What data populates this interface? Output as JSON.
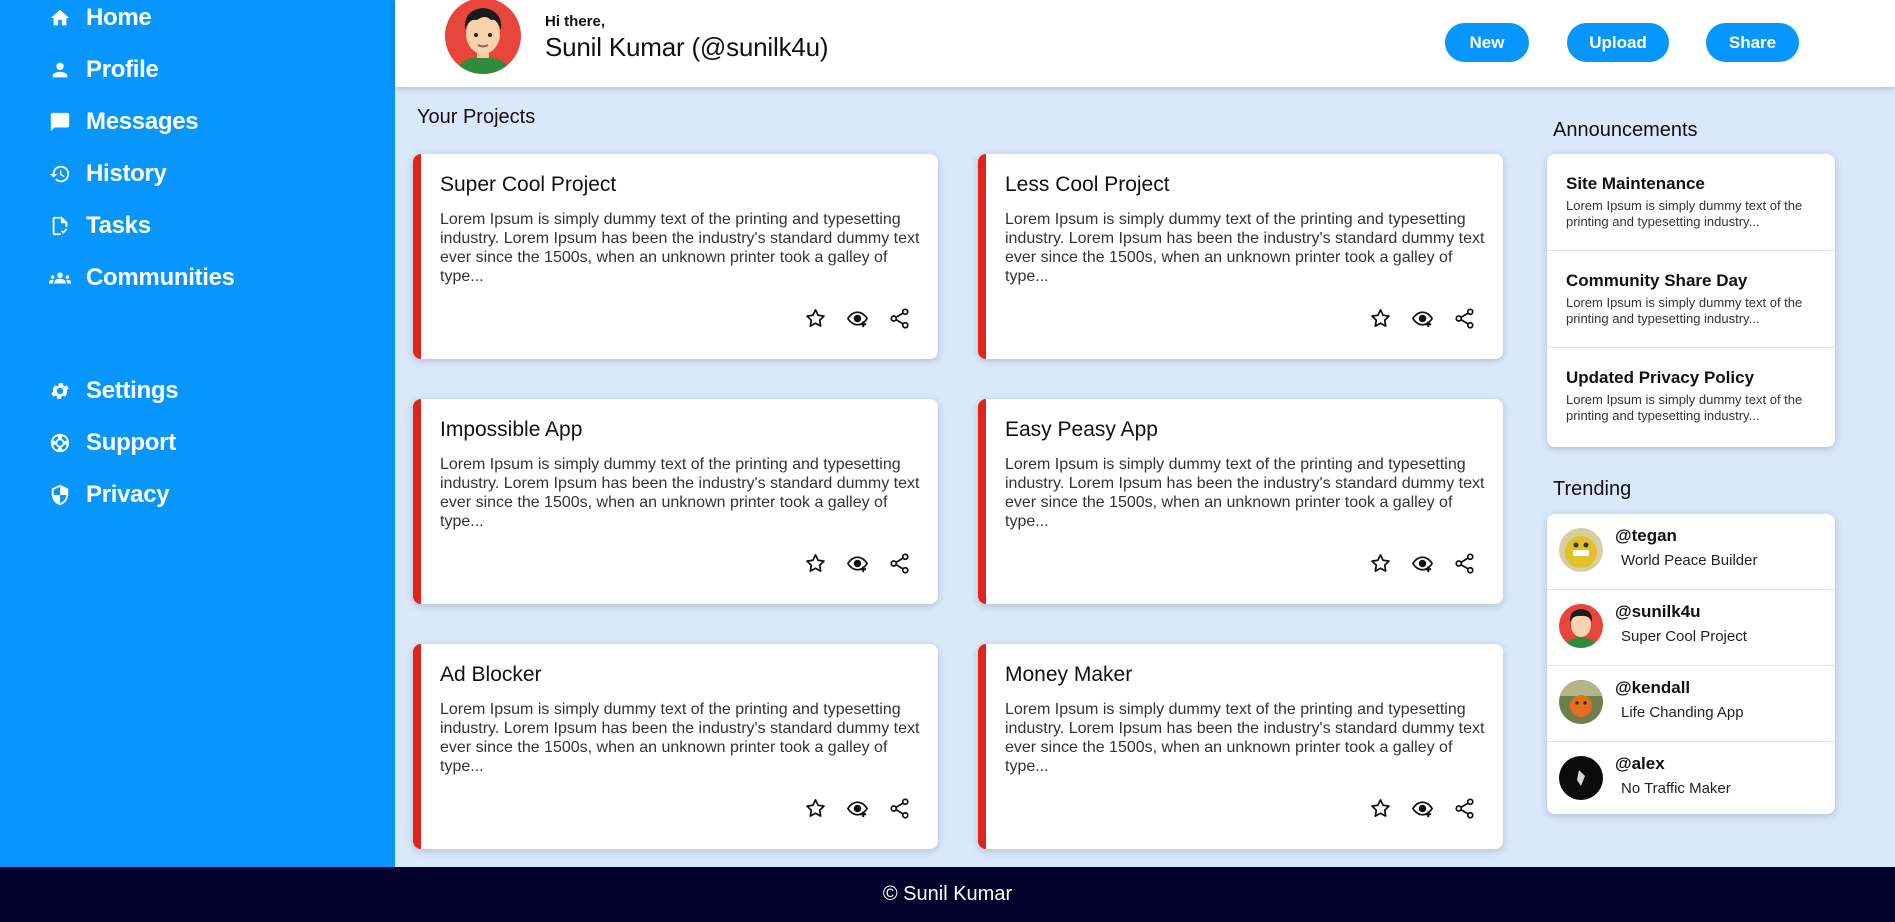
{
  "sidebar": {
    "items": [
      {
        "label": "Home",
        "icon": "home-icon"
      },
      {
        "label": "Profile",
        "icon": "user-icon"
      },
      {
        "label": "Messages",
        "icon": "chat-icon"
      },
      {
        "label": "History",
        "icon": "history-icon"
      },
      {
        "label": "Tasks",
        "icon": "task-icon"
      },
      {
        "label": "Communities",
        "icon": "group-icon"
      },
      {
        "label": "Settings",
        "icon": "gear-icon"
      },
      {
        "label": "Support",
        "icon": "lifebuoy-icon"
      },
      {
        "label": "Privacy",
        "icon": "shield-icon"
      }
    ]
  },
  "header": {
    "greeting": "Hi there,",
    "user_name": "Sunil Kumar (@sunilk4u)",
    "buttons": {
      "new": "New",
      "upload": "Upload",
      "share": "Share"
    }
  },
  "projects": {
    "title": "Your Projects",
    "items": [
      {
        "title": "Super Cool Project",
        "text": "Lorem Ipsum is simply dummy text of the printing and typesetting industry. Lorem Ipsum has been the industry's standard dummy text ever since the 1500s, when an unknown printer took a galley of type..."
      },
      {
        "title": "Less Cool Project",
        "text": "Lorem Ipsum is simply dummy text of the printing and typesetting industry. Lorem Ipsum has been the industry's standard dummy text ever since the 1500s, when an unknown printer took a galley of type..."
      },
      {
        "title": "Impossible App",
        "text": "Lorem Ipsum is simply dummy text of the printing and typesetting industry. Lorem Ipsum has been the industry's standard dummy text ever since the 1500s, when an unknown printer took a galley of type..."
      },
      {
        "title": "Easy Peasy App",
        "text": "Lorem Ipsum is simply dummy text of the printing and typesetting industry. Lorem Ipsum has been the industry's standard dummy text ever since the 1500s, when an unknown printer took a galley of type..."
      },
      {
        "title": "Ad Blocker",
        "text": "Lorem Ipsum is simply dummy text of the printing and typesetting industry. Lorem Ipsum has been the industry's standard dummy text ever since the 1500s, when an unknown printer took a galley of type..."
      },
      {
        "title": "Money Maker",
        "text": "Lorem Ipsum is simply dummy text of the printing and typesetting industry. Lorem Ipsum has been the industry's standard dummy text ever since the 1500s, when an unknown printer took a galley of type..."
      }
    ]
  },
  "announcements": {
    "title": "Announcements",
    "items": [
      {
        "title": "Site Maintenance",
        "text": "Lorem Ipsum is simply dummy text of the printing and typesetting industry..."
      },
      {
        "title": "Community Share Day",
        "text": "Lorem Ipsum is simply dummy text of the printing and typesetting industry..."
      },
      {
        "title": "Updated Privacy Policy",
        "text": "Lorem Ipsum is simply dummy text of the printing and typesetting industry..."
      }
    ]
  },
  "trending": {
    "title": "Trending",
    "items": [
      {
        "handle": "@tegan",
        "project": "World Peace Builder"
      },
      {
        "handle": "@sunilk4u",
        "project": "Super Cool Project"
      },
      {
        "handle": "@kendall",
        "project": "Life Chanding App"
      },
      {
        "handle": "@alex",
        "project": "No Traffic Maker"
      }
    ]
  },
  "footer": {
    "text": "© Sunil Kumar"
  },
  "colors": {
    "primary": "#0796fd",
    "accent": "#e0241b",
    "background": "#d9e8fb",
    "footer": "#01032c"
  }
}
